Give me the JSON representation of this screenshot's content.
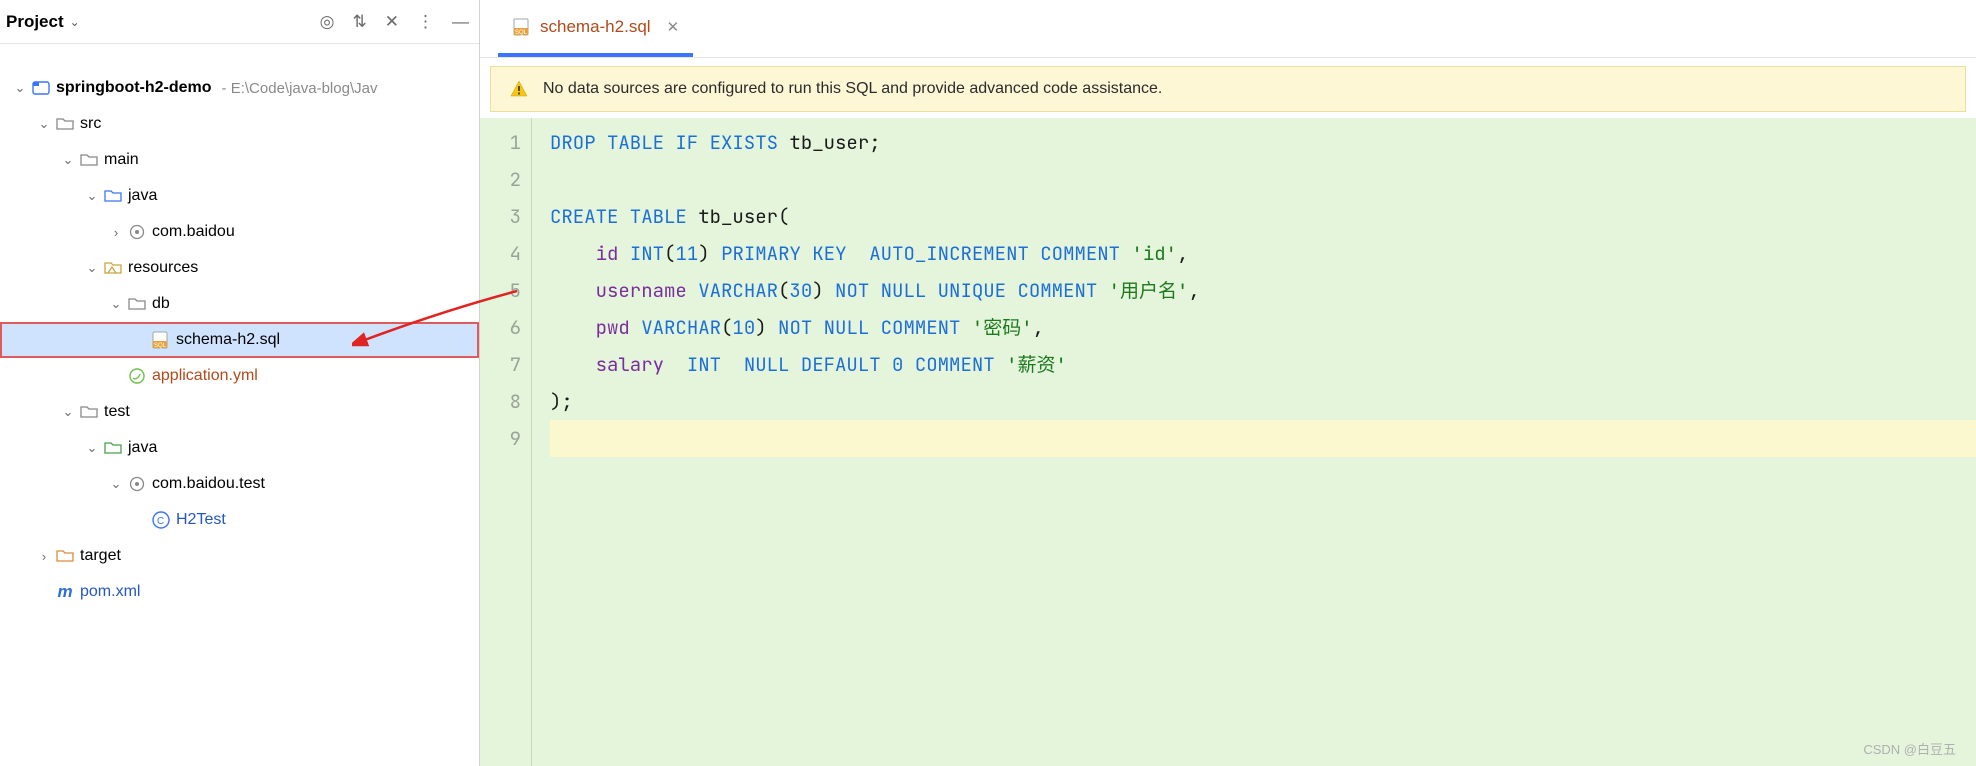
{
  "sidebar": {
    "title": "Project",
    "root": {
      "name": "springboot-h2-demo",
      "path": "- E:\\Code\\java-blog\\Jav"
    },
    "nodes": {
      "src": "src",
      "main": "main",
      "java_main": "java",
      "pkg_main": "com.baidou",
      "resources": "resources",
      "db": "db",
      "schema": "schema-h2.sql",
      "appyml": "application.yml",
      "test": "test",
      "java_test": "java",
      "pkg_test": "com.baidou.test",
      "h2test": "H2Test",
      "target": "target",
      "pom": "pom.xml"
    }
  },
  "tab": {
    "filename": "schema-h2.sql"
  },
  "banner": {
    "text": "No data sources are configured to run this SQL and provide advanced code assistance."
  },
  "code": {
    "lines": [
      "1",
      "2",
      "3",
      "4",
      "5",
      "6",
      "7",
      "8",
      "9"
    ],
    "l1": {
      "a": "DROP TABLE IF EXISTS",
      "b": " tb_user;"
    },
    "l3": {
      "a": "CREATE TABLE",
      "b": " tb_user("
    },
    "l4": {
      "a": "    ",
      "col": "id",
      "b": " INT",
      "p": "(",
      "n": "11",
      "q": ") ",
      "kw": "PRIMARY KEY  AUTO_INCREMENT COMMENT",
      "s": " 'id'",
      "c": ","
    },
    "l5": {
      "a": "    ",
      "col": "username",
      "b": " VARCHAR",
      "p": "(",
      "n": "30",
      "q": ") ",
      "kw": "NOT NULL UNIQUE COMMENT",
      "s": " '用户名'",
      "c": ","
    },
    "l6": {
      "a": "    ",
      "col": "pwd",
      "b": " VARCHAR",
      "p": "(",
      "n": "10",
      "q": ") ",
      "kw": "NOT NULL COMMENT",
      "s": " '密码'",
      "c": ","
    },
    "l7": {
      "a": "    ",
      "col": "salary",
      "b": "  INT  ",
      "kw": "NULL DEFAULT",
      "sp": " ",
      "z": "0",
      "sp2": " ",
      "kw2": "COMMENT",
      "s": " '薪资'"
    },
    "l8": ");"
  },
  "watermark": "CSDN @白豆五"
}
